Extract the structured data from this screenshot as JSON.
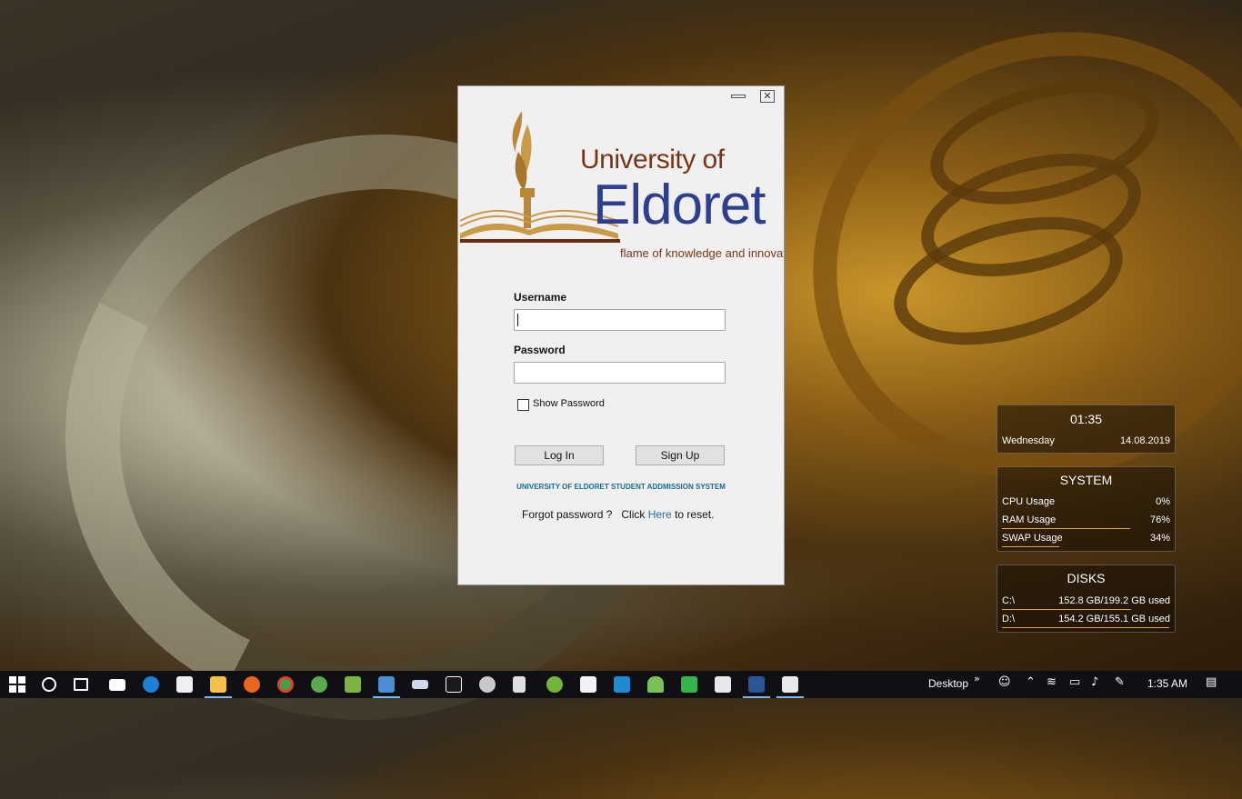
{
  "window": {
    "minimize_glyph": "",
    "close_glyph": "✕"
  },
  "logo": {
    "line1": "University of",
    "line2": "Eldoret",
    "tagline": "flame of knowledge and innovatio"
  },
  "form": {
    "username_label": "Username",
    "username_value": "",
    "password_label": "Password",
    "password_value": "",
    "show_password_label": "Show Password",
    "show_password_checked": false,
    "login_label": "Log In",
    "signup_label": "Sign Up",
    "system_title": "UNIVERSITY OF ELDORET STUDENT ADDMISSION SYSTEM",
    "forgot_prefix": "Forgot password ?   Click ",
    "forgot_link": "Here",
    "forgot_suffix": " to reset."
  },
  "widgets": {
    "clock": {
      "time": "01:35",
      "day": "Wednesday",
      "date": "14.08.2019"
    },
    "system": {
      "title": "SYSTEM",
      "rows": [
        {
          "label": "CPU Usage",
          "value": "0%",
          "fraction": 0.0
        },
        {
          "label": "RAM Usage",
          "value": "76%",
          "fraction": 0.76
        },
        {
          "label": "SWAP Usage",
          "value": "34%",
          "fraction": 0.34
        }
      ]
    },
    "disks": {
      "title": "DISKS",
      "rows": [
        {
          "label": "C:\\",
          "value": "152.8 GB/199.2 GB used",
          "fraction": 0.767
        },
        {
          "label": "D:\\",
          "value": "154.2 GB/155.1 GB used",
          "fraction": 0.994
        }
      ]
    }
  },
  "taskbar": {
    "desktop_label": "Desktop",
    "time": "1:35 AM",
    "icons": [
      "windows-start-icon",
      "cortana-search-icon",
      "task-view-icon",
      "mail-icon",
      "edge-icon",
      "store-icon",
      "file-explorer-icon",
      "firefox-icon",
      "chrome-icon",
      "sourcetree-icon",
      "minecraft-icon",
      "virtualbox-icon",
      "network-tool-icon",
      "intellij-icon",
      "ssh-icon",
      "inkscape-icon",
      "utorrent-icon",
      "paint-icon",
      "vscode-icon",
      "android-studio-icon",
      "green-app-icon",
      "qbittorrent-icon",
      "word-icon",
      "java-app-icon"
    ],
    "accent": "#76b9ed"
  }
}
